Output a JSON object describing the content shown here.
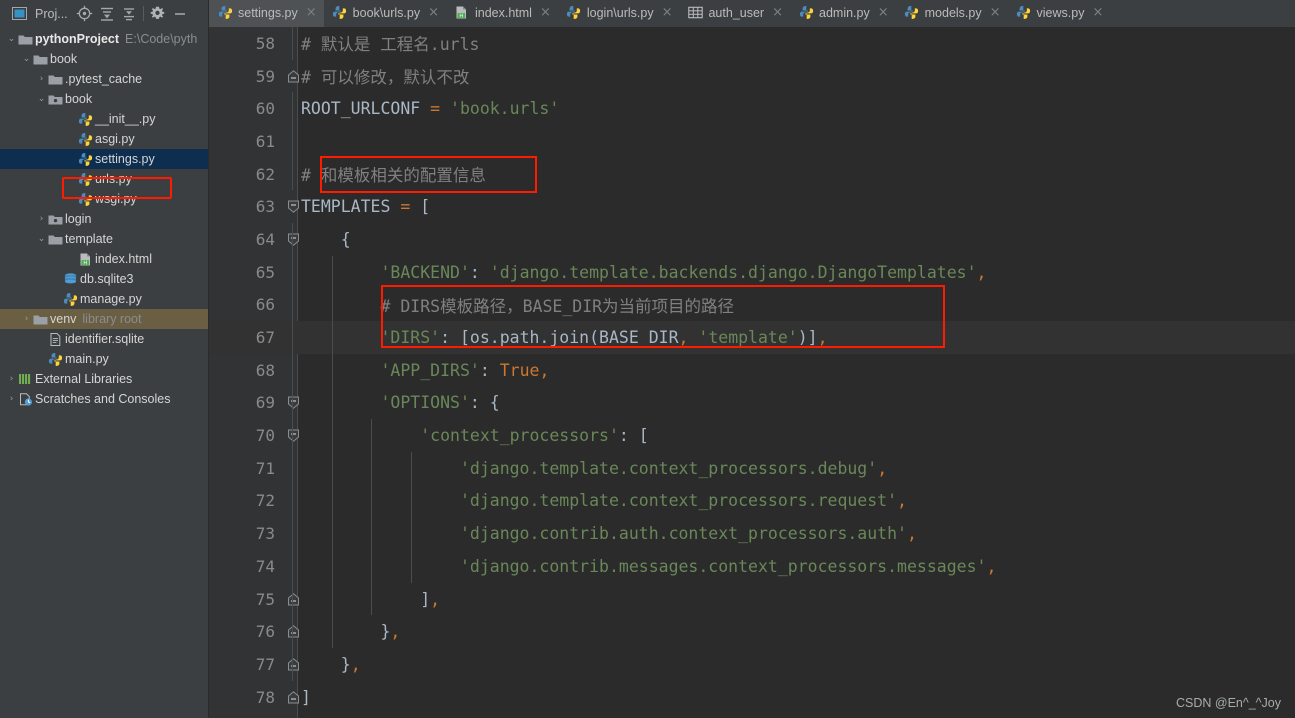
{
  "window": {
    "theme_bg": "#3c3f41",
    "editor_bg": "#2b2b2b",
    "accent_highlight": "#ff1a00",
    "selection_bg": "#0d2e4f"
  },
  "toolbar": {
    "project_label": "Proj...",
    "icons": [
      {
        "name": "project-panel-icon"
      },
      {
        "name": "locate-target-icon"
      },
      {
        "name": "expand-all-icon"
      },
      {
        "name": "collapse-all-icon"
      },
      {
        "name": "gear-icon"
      },
      {
        "name": "minimize-icon"
      }
    ]
  },
  "tabs": [
    {
      "label": "settings.py",
      "icon": "python-file-icon",
      "active": true,
      "close": "×"
    },
    {
      "label": "book\\urls.py",
      "icon": "python-file-icon",
      "active": false,
      "close": "×"
    },
    {
      "label": "index.html",
      "icon": "html-file-icon",
      "active": false,
      "close": "×"
    },
    {
      "label": "login\\urls.py",
      "icon": "python-file-icon",
      "active": false,
      "close": "×"
    },
    {
      "label": "auth_user",
      "icon": "database-table-icon",
      "active": false,
      "close": "×"
    },
    {
      "label": "admin.py",
      "icon": "python-file-icon",
      "active": false,
      "close": "×"
    },
    {
      "label": "models.py",
      "icon": "python-file-icon",
      "active": false,
      "close": "×"
    },
    {
      "label": "views.py",
      "icon": "python-file-icon",
      "active": false,
      "close": "×"
    }
  ],
  "project_tree": [
    {
      "label": "pythonProject",
      "sub": "E:\\Code\\pyth",
      "indent": 0,
      "arrow": "⌄",
      "icon": "folder-icon",
      "bold": true,
      "state": "none"
    },
    {
      "label": "book",
      "sub": "",
      "indent": 1,
      "arrow": "⌄",
      "icon": "folder-icon",
      "bold": false,
      "state": "none"
    },
    {
      "label": ".pytest_cache",
      "sub": "",
      "indent": 2,
      "arrow": "›",
      "icon": "folder-icon",
      "bold": false,
      "state": "none"
    },
    {
      "label": "book",
      "sub": "",
      "indent": 2,
      "arrow": "⌄",
      "icon": "module-folder-icon",
      "bold": false,
      "state": "none"
    },
    {
      "label": "__init__.py",
      "sub": "",
      "indent": 4,
      "arrow": "",
      "icon": "python-file-icon",
      "bold": false,
      "state": "none"
    },
    {
      "label": "asgi.py",
      "sub": "",
      "indent": 4,
      "arrow": "",
      "icon": "python-file-icon",
      "bold": false,
      "state": "none"
    },
    {
      "label": "settings.py",
      "sub": "",
      "indent": 4,
      "arrow": "",
      "icon": "python-file-icon",
      "bold": false,
      "state": "selected"
    },
    {
      "label": "urls.py",
      "sub": "",
      "indent": 4,
      "arrow": "",
      "icon": "python-file-icon",
      "bold": false,
      "state": "none"
    },
    {
      "label": "wsgi.py",
      "sub": "",
      "indent": 4,
      "arrow": "",
      "icon": "python-file-icon",
      "bold": false,
      "state": "none"
    },
    {
      "label": "login",
      "sub": "",
      "indent": 2,
      "arrow": "›",
      "icon": "module-folder-icon",
      "bold": false,
      "state": "none"
    },
    {
      "label": "template",
      "sub": "",
      "indent": 2,
      "arrow": "⌄",
      "icon": "folder-icon",
      "bold": false,
      "state": "none"
    },
    {
      "label": "index.html",
      "sub": "",
      "indent": 4,
      "arrow": "",
      "icon": "html-file-icon",
      "bold": false,
      "state": "none"
    },
    {
      "label": "db.sqlite3",
      "sub": "",
      "indent": 3,
      "arrow": "",
      "icon": "database-icon",
      "bold": false,
      "state": "none"
    },
    {
      "label": "manage.py",
      "sub": "",
      "indent": 3,
      "arrow": "",
      "icon": "python-file-icon",
      "bold": false,
      "state": "none"
    },
    {
      "label": "venv",
      "sub": "library root",
      "indent": 1,
      "arrow": "›",
      "icon": "folder-icon",
      "bold": false,
      "state": "hover"
    },
    {
      "label": "identifier.sqlite",
      "sub": "",
      "indent": 2,
      "arrow": "",
      "icon": "text-file-icon",
      "bold": false,
      "state": "none"
    },
    {
      "label": "main.py",
      "sub": "",
      "indent": 2,
      "arrow": "",
      "icon": "python-file-icon",
      "bold": false,
      "state": "none"
    },
    {
      "label": "External Libraries",
      "sub": "",
      "indent": 0,
      "arrow": "›",
      "icon": "libraries-icon",
      "bold": false,
      "state": "none"
    },
    {
      "label": "Scratches and Consoles",
      "sub": "",
      "indent": 0,
      "arrow": "›",
      "icon": "scratches-icon",
      "bold": false,
      "state": "none"
    }
  ],
  "tree_highlight": {
    "label": "settings.py-highlight-box"
  },
  "editor": {
    "file": "settings.py",
    "first_line_number": 58,
    "current_line": 67,
    "lines": [
      {
        "n": 58,
        "fold": "",
        "indent_guides": [
          0
        ],
        "tokens": [
          {
            "t": "# 默认是 工程名.urls",
            "c": "c-cm",
            "pre": 0
          }
        ]
      },
      {
        "n": 59,
        "fold": "end",
        "indent_guides": [],
        "tokens": [
          {
            "t": "# 可以修改，默认不改",
            "c": "c-cm",
            "pre": 0
          }
        ]
      },
      {
        "n": 60,
        "fold": "",
        "indent_guides": [
          0
        ],
        "tokens": [
          {
            "t": "ROOT_URLCONF ",
            "c": "c-var",
            "pre": 0
          },
          {
            "t": "= ",
            "c": "c-comma"
          },
          {
            "t": "'book.urls'",
            "c": "c-str"
          }
        ]
      },
      {
        "n": 61,
        "fold": "",
        "indent_guides": [
          0
        ],
        "tokens": []
      },
      {
        "n": 62,
        "fold": "",
        "indent_guides": [
          0
        ],
        "tokens": [
          {
            "t": "# ",
            "c": "c-cm",
            "pre": 0
          },
          {
            "t": "和模板相关的配置信息",
            "c": "c-cm"
          }
        ]
      },
      {
        "n": 63,
        "fold": "start",
        "indent_guides": [],
        "tokens": [
          {
            "t": "TEMPLATES ",
            "c": "c-var",
            "pre": 0
          },
          {
            "t": "= ",
            "c": "c-comma"
          },
          {
            "t": "[",
            "c": "c-br"
          }
        ]
      },
      {
        "n": 64,
        "fold": "start",
        "indent_guides": [
          0
        ],
        "tokens": [
          {
            "t": "{",
            "c": "c-br",
            "pre": 4
          }
        ]
      },
      {
        "n": 65,
        "fold": "",
        "indent_guides": [
          0,
          1
        ],
        "tokens": [
          {
            "t": "'BACKEND'",
            "c": "c-str",
            "pre": 8
          },
          {
            "t": ": ",
            "c": "c-br"
          },
          {
            "t": "'django.template.backends.django.DjangoTemplates'",
            "c": "c-str"
          },
          {
            "t": ",",
            "c": "c-comma"
          }
        ]
      },
      {
        "n": 66,
        "fold": "",
        "indent_guides": [
          0,
          1
        ],
        "tokens": [
          {
            "t": "# DIRS模板路径，BASE_DIR为当前项目的路径",
            "c": "c-cm",
            "pre": 8
          }
        ]
      },
      {
        "n": 67,
        "fold": "",
        "indent_guides": [
          0,
          1
        ],
        "tokens": [
          {
            "t": "'DIRS'",
            "c": "c-str",
            "pre": 8
          },
          {
            "t": ": [os.path.join(BASE_DIR",
            "c": "c-var"
          },
          {
            "t": ", ",
            "c": "c-comma"
          },
          {
            "t": "'template'",
            "c": "c-str"
          },
          {
            "t": ")]",
            "c": "c-var"
          },
          {
            "t": ",",
            "c": "c-comma"
          }
        ]
      },
      {
        "n": 68,
        "fold": "",
        "indent_guides": [
          0,
          1
        ],
        "tokens": [
          {
            "t": "'APP_DIRS'",
            "c": "c-str",
            "pre": 8
          },
          {
            "t": ": ",
            "c": "c-br"
          },
          {
            "t": "True",
            "c": "c-kw"
          },
          {
            "t": ",",
            "c": "c-comma"
          }
        ]
      },
      {
        "n": 69,
        "fold": "start",
        "indent_guides": [
          0,
          1
        ],
        "tokens": [
          {
            "t": "'OPTIONS'",
            "c": "c-str",
            "pre": 8
          },
          {
            "t": ": ",
            "c": "c-br"
          },
          {
            "t": "{",
            "c": "c-br"
          }
        ]
      },
      {
        "n": 70,
        "fold": "start",
        "indent_guides": [
          0,
          1,
          2
        ],
        "tokens": [
          {
            "t": "'context_processors'",
            "c": "c-str",
            "pre": 12
          },
          {
            "t": ": ",
            "c": "c-br"
          },
          {
            "t": "[",
            "c": "c-br"
          }
        ]
      },
      {
        "n": 71,
        "fold": "",
        "indent_guides": [
          0,
          1,
          2,
          3
        ],
        "tokens": [
          {
            "t": "'django.template.context_processors.debug'",
            "c": "c-str",
            "pre": 16
          },
          {
            "t": ",",
            "c": "c-comma"
          }
        ]
      },
      {
        "n": 72,
        "fold": "",
        "indent_guides": [
          0,
          1,
          2,
          3
        ],
        "tokens": [
          {
            "t": "'django.template.context_processors.request'",
            "c": "c-str",
            "pre": 16
          },
          {
            "t": ",",
            "c": "c-comma"
          }
        ]
      },
      {
        "n": 73,
        "fold": "",
        "indent_guides": [
          0,
          1,
          2,
          3
        ],
        "tokens": [
          {
            "t": "'django.contrib.auth.context_processors.auth'",
            "c": "c-str",
            "pre": 16
          },
          {
            "t": ",",
            "c": "c-comma"
          }
        ]
      },
      {
        "n": 74,
        "fold": "",
        "indent_guides": [
          0,
          1,
          2,
          3
        ],
        "tokens": [
          {
            "t": "'django.contrib.messages.context_processors.messages'",
            "c": "c-str",
            "pre": 16
          },
          {
            "t": ",",
            "c": "c-comma"
          }
        ]
      },
      {
        "n": 75,
        "fold": "end",
        "indent_guides": [
          0,
          1,
          2
        ],
        "tokens": [
          {
            "t": "]",
            "c": "c-br",
            "pre": 12
          },
          {
            "t": ",",
            "c": "c-comma"
          }
        ]
      },
      {
        "n": 76,
        "fold": "end",
        "indent_guides": [
          0,
          1
        ],
        "tokens": [
          {
            "t": "}",
            "c": "c-br",
            "pre": 8
          },
          {
            "t": ",",
            "c": "c-comma"
          }
        ]
      },
      {
        "n": 77,
        "fold": "end",
        "indent_guides": [
          0
        ],
        "tokens": [
          {
            "t": "}",
            "c": "c-br",
            "pre": 4
          },
          {
            "t": ",",
            "c": "c-comma"
          }
        ]
      },
      {
        "n": 78,
        "fold": "end",
        "indent_guides": [],
        "tokens": [
          {
            "t": "]",
            "c": "c-br",
            "pre": 0
          }
        ]
      }
    ],
    "highlight_boxes": [
      {
        "name": "comment-line-62-highlight-box"
      },
      {
        "name": "dirs-config-highlight-box"
      }
    ]
  },
  "watermark": {
    "text": "CSDN @En^_^Joy"
  }
}
